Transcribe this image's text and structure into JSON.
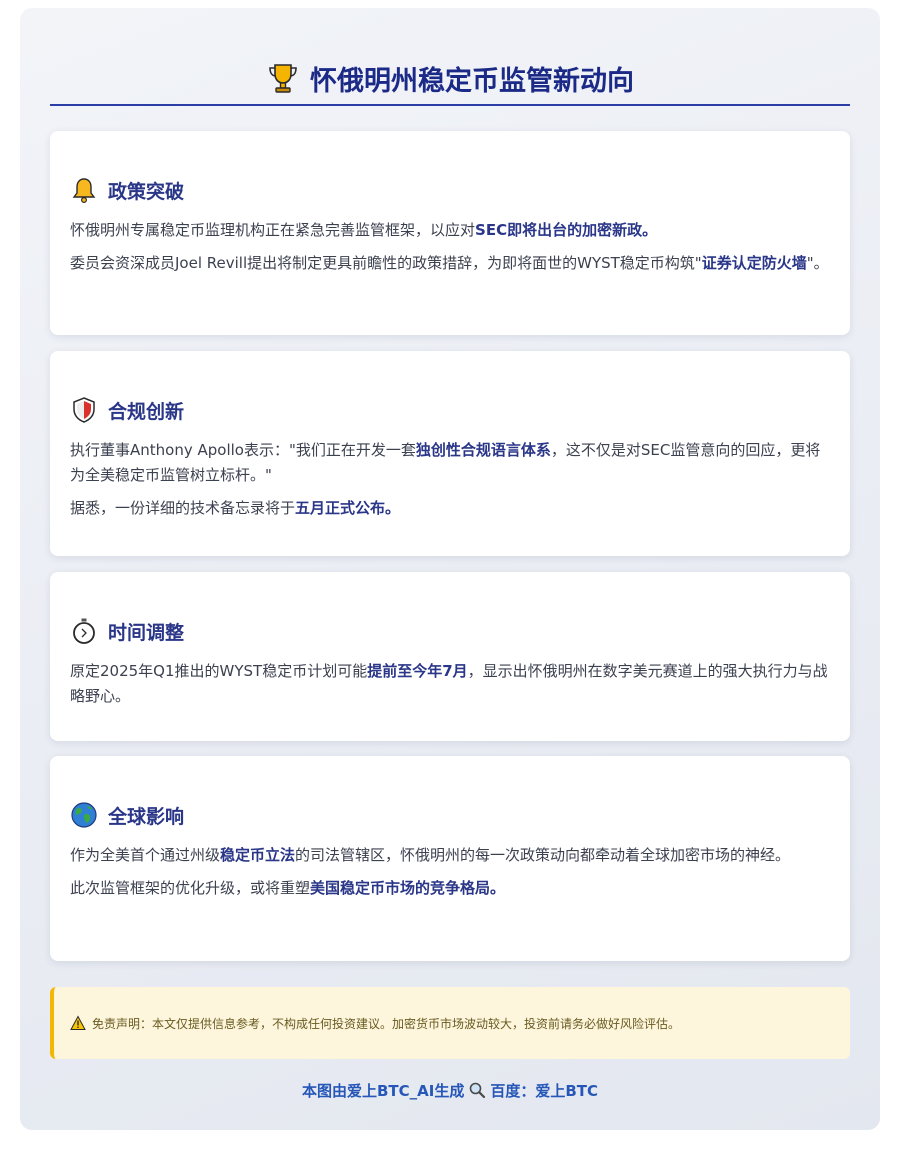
{
  "header": {
    "title": "怀俄明州稳定币监管新动向",
    "icon": "trophy-icon"
  },
  "sections": [
    {
      "title": "政策突破",
      "icon": "bell-icon",
      "paragraphs": [
        [
          {
            "text": "怀俄明州专属稳定币监理机构正在紧急完善监管框架，以应对",
            "bold": false
          },
          {
            "text": "SEC即将出台的加密新政。",
            "bold": true
          }
        ],
        [
          {
            "text": "委员会资深成员Joel Revill提出将制定更具前瞻性的政策措辞，为即将面世的WYST稳定币构筑\"",
            "bold": false
          },
          {
            "text": "证券认定防火墙",
            "bold": true
          },
          {
            "text": "\"。",
            "bold": false
          }
        ]
      ]
    },
    {
      "title": "合规创新",
      "icon": "shield-icon",
      "paragraphs": [
        [
          {
            "text": "执行董事Anthony Apollo表示：\"我们正在开发一套",
            "bold": false
          },
          {
            "text": "独创性合规语言体系",
            "bold": true
          },
          {
            "text": "，这不仅是对SEC监管意向的回应，更将为全美稳定币监管树立标杆。\"",
            "bold": false
          }
        ],
        [
          {
            "text": "据悉，一份详细的技术备忘录将于",
            "bold": false
          },
          {
            "text": "五月正式公布。",
            "bold": true
          }
        ]
      ]
    },
    {
      "title": "时间调整",
      "icon": "stopwatch-icon",
      "paragraphs": [
        [
          {
            "text": "原定2025年Q1推出的WYST稳定币计划可能",
            "bold": false
          },
          {
            "text": "提前至今年7月",
            "bold": true
          },
          {
            "text": "，显示出怀俄明州在数字美元赛道上的强大执行力与战略野心。",
            "bold": false
          }
        ]
      ]
    },
    {
      "title": "全球影响",
      "icon": "globe-icon",
      "paragraphs": [
        [
          {
            "text": "作为全美首个通过州级",
            "bold": false
          },
          {
            "text": "稳定币立法",
            "bold": true
          },
          {
            "text": "的司法管辖区，怀俄明州的每一次政策动向都牵动着全球加密市场的神经。",
            "bold": false
          }
        ],
        [
          {
            "text": "此次监管框架的优化升级，或将重塑",
            "bold": false
          },
          {
            "text": "美国稳定币市场的竞争格局。",
            "bold": true
          }
        ]
      ]
    }
  ],
  "disclaimer": {
    "icon": "warning-icon",
    "text": "免责声明：本文仅提供信息参考，不构成任何投资建议。加密货币市场波动较大，投资前请务必做好风险评估。"
  },
  "footer": {
    "left_text": "本图由爱上BTC_AI生成",
    "icon": "magnifier-icon",
    "right_text": "百度：爱上BTC"
  },
  "colors": {
    "accent": "#2a3688",
    "title": "#1b2a87",
    "warning_border": "#f2b705",
    "footer": "#2657b8"
  }
}
